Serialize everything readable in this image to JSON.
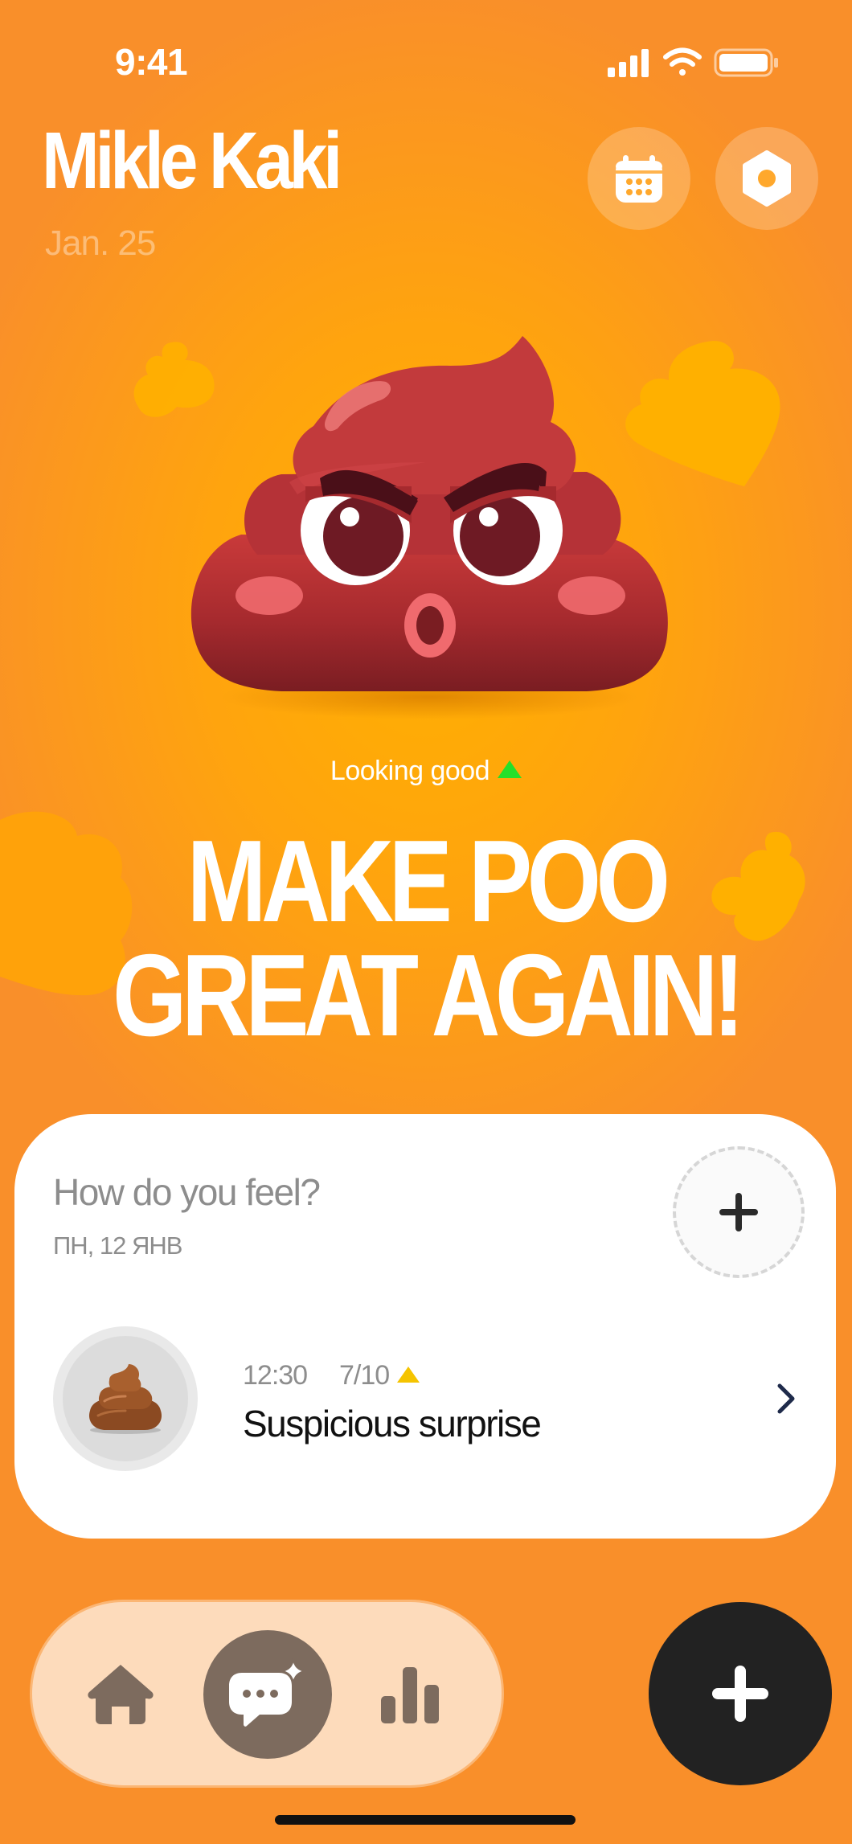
{
  "status_bar": {
    "time": "9:41"
  },
  "header": {
    "name": "Mikle Kaki",
    "date": "Jan. 25"
  },
  "mood": {
    "status_text": "Looking good",
    "status_color": "#24e02a"
  },
  "headline": {
    "line1": "MAKE POO",
    "line2": "GREAT AGAIN!"
  },
  "feel_card": {
    "title": "How do you feel?",
    "subtitle": "ПН, 12 ЯНВ",
    "entry": {
      "time": "12:30",
      "score": "7/10",
      "score_color": "#f5c400",
      "title": "Suspicious surprise",
      "icon": "poop-emoji"
    }
  },
  "nav": {
    "items": [
      "home-icon",
      "chat-sparkle-icon",
      "stats-icon"
    ],
    "active": "chat-sparkle-icon"
  },
  "colors": {
    "background": "#f98f2a",
    "accent_yellow": "#ffb000",
    "fab": "#222222",
    "tabbar": "#fddbbb"
  }
}
